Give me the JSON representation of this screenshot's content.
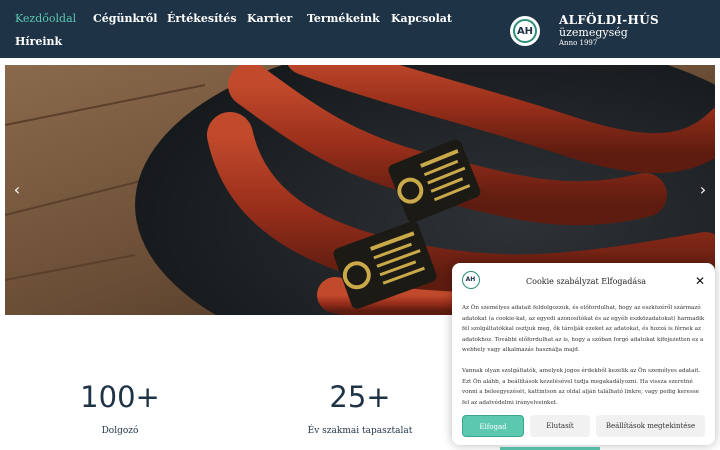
{
  "nav": {
    "items": [
      {
        "label": "Kezdőoldal",
        "active": true
      },
      {
        "label": "Cégünkről"
      },
      {
        "label": "Értékesítés"
      },
      {
        "label": "Karrier"
      },
      {
        "label": "Termékeink"
      },
      {
        "label": "Kapcsolat"
      },
      {
        "label": "Híreink"
      }
    ]
  },
  "brand": {
    "logo_text": "AH",
    "name": "ALFÖLDI-HÚS",
    "subtitle": "üzemegység",
    "year": "Anno 1997"
  },
  "hero": {
    "prev_icon": "‹",
    "next_icon": "›"
  },
  "stats": [
    {
      "value": "100+",
      "label": "Dolgozó"
    },
    {
      "value": "25+",
      "label": "Év szakmai tapasztalat"
    }
  ],
  "cookie": {
    "logo_text": "AH",
    "title": "Cookie szabályzat Elfogadása",
    "close_icon": "✕",
    "text1": "Az Ön személyes adatait feldolgozzuk, és előfordulhat, hogy az eszközéről származó adatokat (a cookie-kat, az egyedi azonosítókat és az egyéb eszközadatokat) harmadik fél szolgáltatókkal osztjuk meg, ők tárolják ezeket az adatokat, és hozzá is férnek az adatokhoz. További előfordulhat az is, hogy a szóban forgó adatokat kifejezetten ez a webhely vagy alkalmazás használja majd.",
    "text2": "Vannak olyan szolgáltatók, amelyek jogos érdekből kezelik az Ön személyes adatait. Ezt Ön alább, a beállítások kezelésével tudja megakadályozni. Ha vissza szeretné vonni a beleegyezését, kattintson az oldal alján található linkre, vagy pedig keresse fel az adatvédelmi irányelveinket.",
    "accept_label": "Elfogad",
    "deny_label": "Elutasít",
    "settings_label": "Beállítások megtekintése"
  },
  "colors": {
    "nav_bg": "#1f3347",
    "accent": "#5cc8b0",
    "text_dark": "#1f3347"
  }
}
